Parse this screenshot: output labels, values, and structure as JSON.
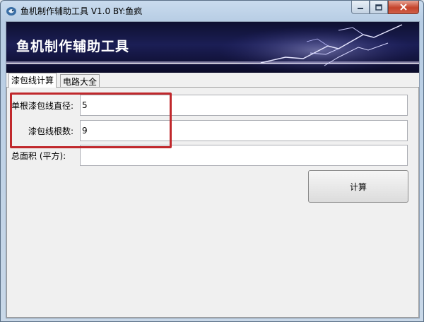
{
  "window": {
    "title": "鱼机制作辅助工具 V1.0  BY:鱼疯",
    "controls": [
      "minimize-icon",
      "maximize-icon",
      "close-icon"
    ]
  },
  "banner": {
    "title": "鱼机制作辅助工具"
  },
  "tabs": [
    {
      "label": "漆包线计算",
      "active": true
    },
    {
      "label": "电路大全",
      "active": false
    }
  ],
  "form": {
    "diameter_label": "单根漆包线直径:",
    "diameter_value": "5",
    "count_label": "漆包线根数:",
    "count_value": "9",
    "area_label": "总面积 (平方):",
    "area_value": ""
  },
  "calc_button": "计算",
  "colors": {
    "highlight": "#c0282c",
    "banner_bg": "#1b1e55"
  }
}
